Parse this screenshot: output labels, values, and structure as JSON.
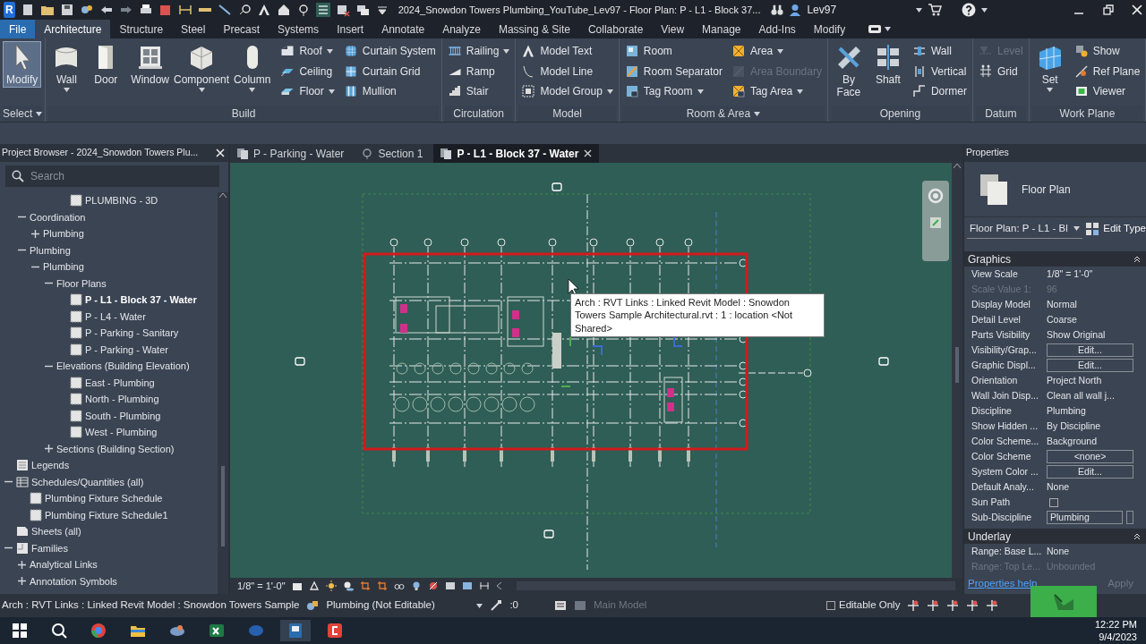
{
  "title_bar": {
    "app_logo": "R",
    "title": "2024_Snowdon Towers Plumbing_YouTube_Lev97 - Floor Plan: P - L1 - Block 37...",
    "user": "Lev97"
  },
  "ribbon_tabs": [
    {
      "label": "File",
      "kind": "file",
      "selected": false
    },
    {
      "label": "Architecture",
      "kind": "tab",
      "selected": true
    },
    {
      "label": "Structure",
      "kind": "tab",
      "selected": false
    },
    {
      "label": "Steel",
      "kind": "tab",
      "selected": false
    },
    {
      "label": "Precast",
      "kind": "tab",
      "selected": false
    },
    {
      "label": "Systems",
      "kind": "tab",
      "selected": false
    },
    {
      "label": "Insert",
      "kind": "tab",
      "selected": false
    },
    {
      "label": "Annotate",
      "kind": "tab",
      "selected": false
    },
    {
      "label": "Analyze",
      "kind": "tab",
      "selected": false
    },
    {
      "label": "Massing & Site",
      "kind": "tab",
      "selected": false
    },
    {
      "label": "Collaborate",
      "kind": "tab",
      "selected": false
    },
    {
      "label": "View",
      "kind": "tab",
      "selected": false
    },
    {
      "label": "Manage",
      "kind": "tab",
      "selected": false
    },
    {
      "label": "Add-Ins",
      "kind": "tab",
      "selected": false
    },
    {
      "label": "Modify",
      "kind": "tab",
      "selected": false
    }
  ],
  "ribbon": {
    "panels": [
      {
        "title": "Select",
        "title_dropdown": true,
        "groups": [
          {
            "kind": "large",
            "tools": [
              {
                "label": "Modify",
                "dropdown": false,
                "disabled": false,
                "selected": true
              }
            ]
          }
        ]
      },
      {
        "title": "Build",
        "title_dropdown": false,
        "groups": [
          {
            "kind": "large",
            "tools": [
              {
                "label": "Wall",
                "dropdown": true,
                "disabled": false,
                "selected": false
              },
              {
                "label": "Door",
                "dropdown": false,
                "disabled": false,
                "selected": false
              },
              {
                "label": "Window",
                "dropdown": false,
                "disabled": false,
                "selected": false
              },
              {
                "label": "Component",
                "dropdown": true,
                "disabled": false,
                "selected": false
              },
              {
                "label": "Column",
                "dropdown": true,
                "disabled": false,
                "selected": false
              }
            ]
          },
          {
            "kind": "stack",
            "tools": [
              {
                "label": "Roof",
                "dropdown": true,
                "disabled": false,
                "selected": false
              },
              {
                "label": "Ceiling",
                "dropdown": false,
                "disabled": false,
                "selected": false
              },
              {
                "label": "Floor",
                "dropdown": true,
                "disabled": false,
                "selected": false
              }
            ]
          },
          {
            "kind": "stack",
            "tools": [
              {
                "label": "Curtain System",
                "dropdown": false,
                "disabled": false,
                "selected": false
              },
              {
                "label": "Curtain Grid",
                "dropdown": false,
                "disabled": false,
                "selected": false
              },
              {
                "label": "Mullion",
                "dropdown": false,
                "disabled": false,
                "selected": false
              }
            ]
          }
        ]
      },
      {
        "title": "Circulation",
        "title_dropdown": false,
        "groups": [
          {
            "kind": "stack",
            "tools": [
              {
                "label": "Railing",
                "dropdown": true,
                "disabled": false,
                "selected": false
              },
              {
                "label": "Ramp",
                "dropdown": false,
                "disabled": false,
                "selected": false
              },
              {
                "label": "Stair",
                "dropdown": false,
                "disabled": false,
                "selected": false
              }
            ]
          }
        ]
      },
      {
        "title": "Model",
        "title_dropdown": false,
        "groups": [
          {
            "kind": "stack",
            "tools": [
              {
                "label": "Model Text",
                "dropdown": false,
                "disabled": false,
                "selected": false
              },
              {
                "label": "Model Line",
                "dropdown": false,
                "disabled": false,
                "selected": false
              },
              {
                "label": "Model Group",
                "dropdown": true,
                "disabled": false,
                "selected": false
              }
            ]
          }
        ]
      },
      {
        "title": "Room & Area",
        "title_dropdown": true,
        "groups": [
          {
            "kind": "stack",
            "tools": [
              {
                "label": "Room",
                "dropdown": false,
                "disabled": false,
                "selected": false
              },
              {
                "label": "Room Separator",
                "dropdown": false,
                "disabled": false,
                "selected": false
              },
              {
                "label": "Tag Room",
                "dropdown": true,
                "disabled": false,
                "selected": false
              }
            ]
          },
          {
            "kind": "stack",
            "tools": [
              {
                "label": "Area",
                "dropdown": true,
                "disabled": false,
                "selected": false
              },
              {
                "label": "Area Boundary",
                "dropdown": false,
                "disabled": true,
                "selected": false
              },
              {
                "label": "Tag Area",
                "dropdown": true,
                "disabled": false,
                "selected": false
              }
            ]
          }
        ]
      },
      {
        "title": "Opening",
        "title_dropdown": false,
        "groups": [
          {
            "kind": "large",
            "tools": [
              {
                "label": "By Face",
                "dropdown": false,
                "disabled": false,
                "selected": false
              },
              {
                "label": "Shaft",
                "dropdown": false,
                "disabled": false,
                "selected": false
              }
            ]
          },
          {
            "kind": "stack",
            "tools": [
              {
                "label": "Wall",
                "dropdown": false,
                "disabled": false,
                "selected": false
              },
              {
                "label": "Vertical",
                "dropdown": false,
                "disabled": false,
                "selected": false
              },
              {
                "label": "Dormer",
                "dropdown": false,
                "disabled": false,
                "selected": false
              }
            ]
          }
        ]
      },
      {
        "title": "Datum",
        "title_dropdown": false,
        "groups": [
          {
            "kind": "stack",
            "tools": [
              {
                "label": "Level",
                "dropdown": false,
                "disabled": true,
                "selected": false
              },
              {
                "label": "Grid",
                "dropdown": false,
                "disabled": false,
                "selected": false
              }
            ]
          }
        ]
      },
      {
        "title": "Work Plane",
        "title_dropdown": false,
        "groups": [
          {
            "kind": "large",
            "tools": [
              {
                "label": "Set",
                "dropdown": true,
                "disabled": false,
                "selected": false
              }
            ]
          },
          {
            "kind": "stack",
            "tools": [
              {
                "label": "Show",
                "dropdown": false,
                "disabled": false,
                "selected": false
              },
              {
                "label": "Ref Plane",
                "dropdown": false,
                "disabled": false,
                "selected": false
              },
              {
                "label": "Viewer",
                "dropdown": false,
                "disabled": false,
                "selected": false
              }
            ]
          }
        ]
      }
    ]
  },
  "project_browser": {
    "title": "Project Browser - 2024_Snowdon Towers Plu...",
    "search": {
      "placeholder": "Search"
    },
    "tree": [
      {
        "children": [
          {
            "children": [
              {
                "children": [
                  {
                    "children": [
                      {
                        "label": "PLUMBING - 3D",
                        "kind": "view",
                        "selected": false
                      }
                    ]
                  }
                ]
              }
            ]
          },
          {
            "label": "Coordination",
            "expanded": true,
            "selected": false,
            "children": [
              {
                "label": "Plumbing",
                "expanded": false,
                "selected": false
              }
            ]
          },
          {
            "label": "Plumbing",
            "expanded": true,
            "selected": false,
            "children": [
              {
                "label": "Plumbing",
                "expanded": true,
                "selected": false,
                "children": [
                  {
                    "label": "Floor Plans",
                    "expanded": true,
                    "selected": false,
                    "children": [
                      {
                        "label": "P - L1 - Block 37 - Water",
                        "kind": "view",
                        "selected": true
                      },
                      {
                        "label": "P - L4 - Water",
                        "kind": "view",
                        "selected": false
                      },
                      {
                        "label": "P - Parking - Sanitary",
                        "kind": "view",
                        "selected": false
                      },
                      {
                        "label": "P - Parking - Water",
                        "kind": "view",
                        "selected": false
                      }
                    ]
                  },
                  {
                    "label": "Elevations (Building Elevation)",
                    "expanded": true,
                    "selected": false,
                    "children": [
                      {
                        "label": "East - Plumbing",
                        "kind": "view",
                        "selected": false
                      },
                      {
                        "label": "North - Plumbing",
                        "kind": "view",
                        "selected": false
                      },
                      {
                        "label": "South - Plumbing",
                        "kind": "view",
                        "selected": false
                      },
                      {
                        "label": "West - Plumbing",
                        "kind": "view",
                        "selected": false
                      }
                    ]
                  },
                  {
                    "label": "Sections (Building Section)",
                    "expanded": false,
                    "selected": false
                  }
                ]
              }
            ]
          }
        ]
      },
      {
        "label": "Legends",
        "kind": "legends",
        "selected": false
      },
      {
        "label": "Schedules/Quantities (all)",
        "kind": "schedules",
        "expanded": true,
        "selected": false,
        "children": [
          {
            "label": "Plumbing Fixture Schedule",
            "kind": "schedule",
            "selected": false
          },
          {
            "label": "Plumbing Fixture Schedule1",
            "kind": "schedule",
            "selected": false
          }
        ]
      },
      {
        "label": "Sheets (all)",
        "kind": "sheets",
        "selected": false
      },
      {
        "label": "Families",
        "kind": "families",
        "expanded": true,
        "selected": false,
        "children": [
          {
            "label": "Analytical Links",
            "expanded": false,
            "selected": false
          },
          {
            "label": "Annotation Symbols",
            "expanded": false,
            "selected": false
          }
        ]
      }
    ]
  },
  "view_tabs": [
    {
      "label": "P - Parking - Water",
      "kind": "plan",
      "selected": false,
      "closable": false
    },
    {
      "label": "Section 1",
      "kind": "section",
      "selected": false,
      "closable": false
    },
    {
      "label": "P - L1 - Block 37 - Water",
      "kind": "plan",
      "selected": true,
      "closable": true
    }
  ],
  "canvas": {
    "tooltip": "Arch : RVT Links : Linked Revit Model : Snowdon Towers Sample Architectural.rvt : 1 : location <Not Shared>"
  },
  "view_control_bar": {
    "scale": "1/8\" = 1'-0\""
  },
  "properties": {
    "title": "Properties",
    "type_name": "Floor Plan",
    "type_selector": "Floor Plan: P - L1 - Bl",
    "edit_type": "Edit Type",
    "groups": [
      {
        "title": "Graphics",
        "expanded": true,
        "rows": [
          {
            "label": "View Scale",
            "value": "1/8\" = 1'-0\"",
            "kind": "text",
            "disabled": false
          },
          {
            "label": "Scale Value 1:",
            "value": "96",
            "kind": "text",
            "disabled": true
          },
          {
            "label": "Display Model",
            "value": "Normal",
            "kind": "text",
            "disabled": false
          },
          {
            "label": "Detail Level",
            "value": "Coarse",
            "kind": "text",
            "disabled": false
          },
          {
            "label": "Parts Visibility",
            "value": "Show Original",
            "kind": "text",
            "disabled": false
          },
          {
            "label": "Visibility/Grap...",
            "value": "Edit...",
            "kind": "button",
            "disabled": false
          },
          {
            "label": "Graphic Displ...",
            "value": "Edit...",
            "kind": "button",
            "disabled": false
          },
          {
            "label": "Orientation",
            "value": "Project North",
            "kind": "text",
            "disabled": false
          },
          {
            "label": "Wall Join Disp...",
            "value": "Clean all wall j...",
            "kind": "text",
            "disabled": false
          },
          {
            "label": "Discipline",
            "value": "Plumbing",
            "kind": "text",
            "disabled": false
          },
          {
            "label": "Show Hidden ...",
            "value": "By Discipline",
            "kind": "text",
            "disabled": false
          },
          {
            "label": "Color Scheme...",
            "value": "Background",
            "kind": "text",
            "disabled": false
          },
          {
            "label": "Color Scheme",
            "value": "<none>",
            "kind": "button",
            "disabled": false
          },
          {
            "label": "System Color ...",
            "value": "Edit...",
            "kind": "button",
            "disabled": false
          },
          {
            "label": "Default Analy...",
            "value": "None",
            "kind": "text",
            "disabled": false
          },
          {
            "label": "Sun Path",
            "kind": "checkbox",
            "checked": false,
            "disabled": false
          },
          {
            "label": "Sub-Discipline",
            "value": "Plumbing",
            "kind": "field",
            "disabled": false
          }
        ]
      },
      {
        "title": "Underlay",
        "expanded": true,
        "rows": [
          {
            "label": "Range: Base L...",
            "value": "None",
            "kind": "text",
            "disabled": false
          },
          {
            "label": "Range: Top Le...",
            "value": "Unbounded",
            "kind": "text",
            "disabled": true
          }
        ]
      }
    ],
    "help": "Properties help",
    "apply": {
      "label": "Apply",
      "disabled": true
    }
  },
  "status_bar": {
    "message": "Arch : RVT Links : Linked Revit Model : Snowdon Towers Sample",
    "workset": "Plumbing (Not Editable)",
    "active_count": ":0",
    "design_option": "Main Model",
    "editable_only": {
      "label": "Editable Only",
      "checked": false
    }
  },
  "taskbar": {
    "time": "12:22 PM",
    "date": "9/4/2023"
  }
}
